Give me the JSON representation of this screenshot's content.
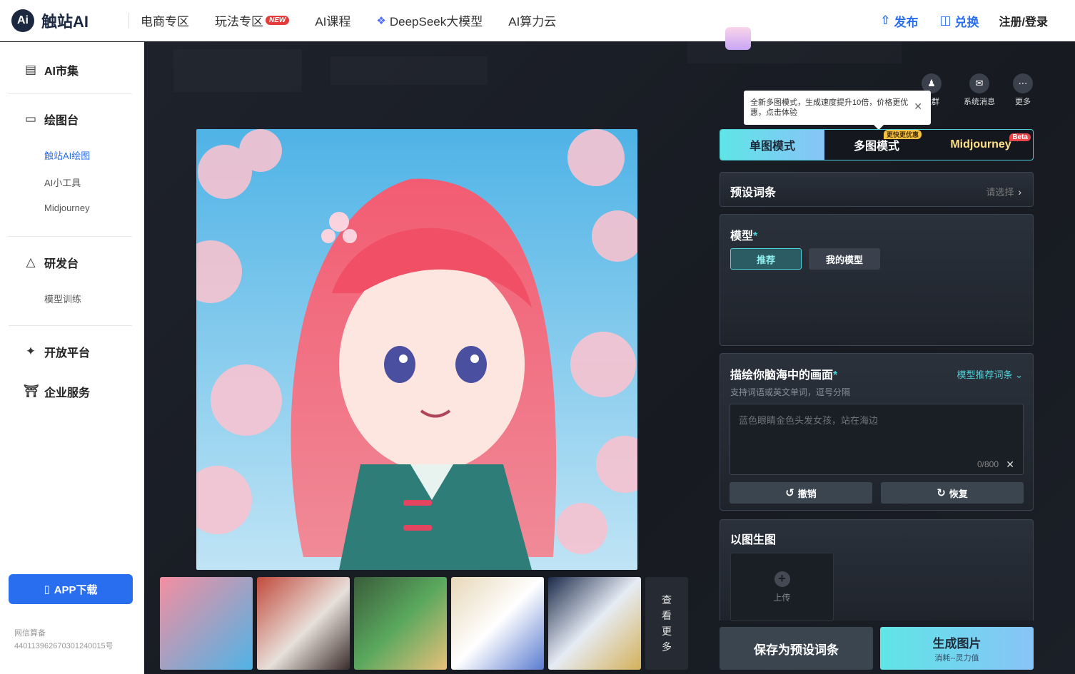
{
  "header": {
    "logo_mark": "Ai",
    "logo_text": "触站AI",
    "nav": [
      {
        "label": "电商专区"
      },
      {
        "label": "玩法专区",
        "badge": "NEW"
      },
      {
        "label": "AI课程"
      },
      {
        "label": "DeepSeek大模型"
      },
      {
        "label": "AI算力云"
      }
    ],
    "publish": "发布",
    "redeem": "兑换",
    "login": "注册/登录"
  },
  "sidebar": {
    "market": "AI市集",
    "drawing": "绘图台",
    "drawing_items": [
      "触站AI绘图",
      "AI小工具",
      "Midjourney"
    ],
    "lab": "研发台",
    "lab_items": [
      "模型训练"
    ],
    "open_platform": "开放平台",
    "enterprise": "企业服务",
    "app_download": "APP下载",
    "icp_label": "网信算备",
    "icp_number": "440113962670301240015号"
  },
  "toolbar_icons": [
    {
      "label": "社群",
      "icon": "community-icon"
    },
    {
      "label": "系统消息",
      "icon": "mail-icon"
    },
    {
      "label": "更多",
      "icon": "more-icon"
    }
  ],
  "tooltip": {
    "text": "全新多图模式，生成速度提升10倍，价格更优惠，点击体验"
  },
  "modes": {
    "single": "单图模式",
    "multi": "多图模式",
    "multi_badge": "更快更优惠",
    "midjourney": "Midjourney",
    "mj_badge": "Beta"
  },
  "preset": {
    "title": "预设词条",
    "placeholder": "请选择"
  },
  "model": {
    "title": "模型",
    "tabs": [
      "推荐",
      "我的模型"
    ]
  },
  "prompt": {
    "title": "描绘你脑海中的画面",
    "recommend": "模型推荐词条",
    "hint": "支持词语或英文单词，逗号分隔",
    "placeholder": "蓝色眼睛金色头发女孩，站在海边",
    "counter": "0/800",
    "undo": "撤销",
    "redo": "恢复"
  },
  "img2img": {
    "title": "以图生图",
    "upload": "上传"
  },
  "actions": {
    "save_preset": "保存为预设词条",
    "generate": "生成图片",
    "generate_sub": "消耗--灵力值"
  },
  "gallery": {
    "view_more": [
      "查",
      "看",
      "更",
      "多"
    ]
  },
  "colors": {
    "accent": "#4fd1d9",
    "brand_blue": "#2a6ef0",
    "badge_red": "#e63b3b"
  }
}
